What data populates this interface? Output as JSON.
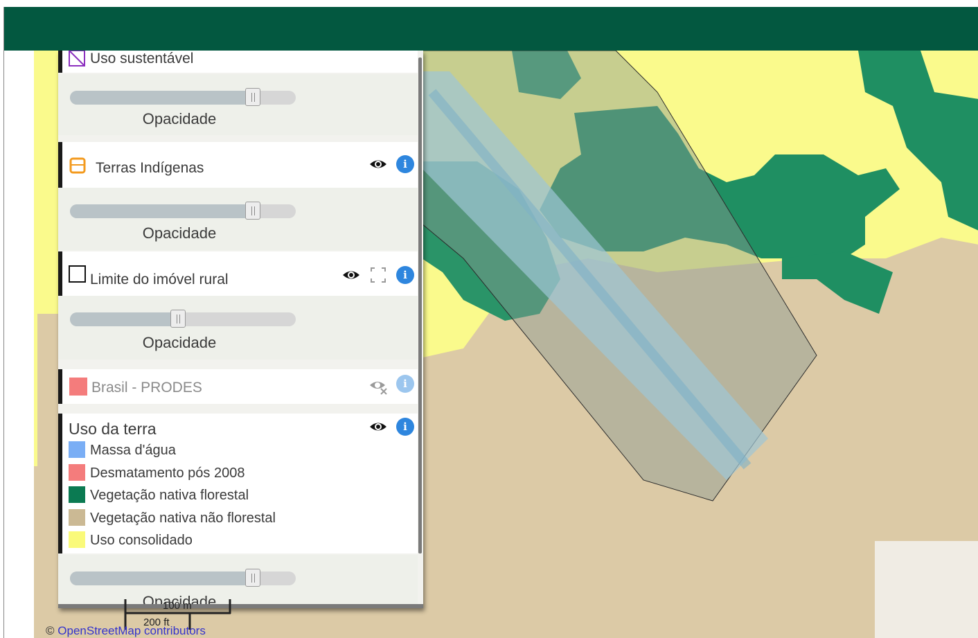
{
  "layers": [
    {
      "name": "Uso sustentável",
      "icon": "purple-hatched-square-icon"
    },
    {
      "name": "Terras Indígenas",
      "icon": "orange-outlined-square-icon"
    },
    {
      "name": "Limite do imóvel rural",
      "icon": "black-outlined-square-icon"
    },
    {
      "name": "Brasil - PRODES",
      "icon": "pink-square-icon"
    },
    {
      "name": "Uso da terra"
    }
  ],
  "opacity_label": "Opacidade",
  "opacity_values": [
    0.81,
    0.81,
    0.48,
    0.81
  ],
  "legend": [
    {
      "label": "Massa d'água",
      "color": "#7aaef5"
    },
    {
      "label": "Desmatamento pós 2008",
      "color": "#f47c7c"
    },
    {
      "label": "Vegetação nativa florestal",
      "color": "#0b7a52"
    },
    {
      "label": "Vegetação nativa não florestal",
      "color": "#cbb994"
    },
    {
      "label": "Uso consolidado",
      "color": "#fafa7a"
    }
  ],
  "scale": {
    "metric": "100 m",
    "imperial": "200 ft"
  },
  "attribution": {
    "symbol": "©",
    "text": "OpenStreetMap contributors"
  },
  "colors": {
    "header": "#035840",
    "info": "#2e86de",
    "map_background": "#dccaa6"
  }
}
